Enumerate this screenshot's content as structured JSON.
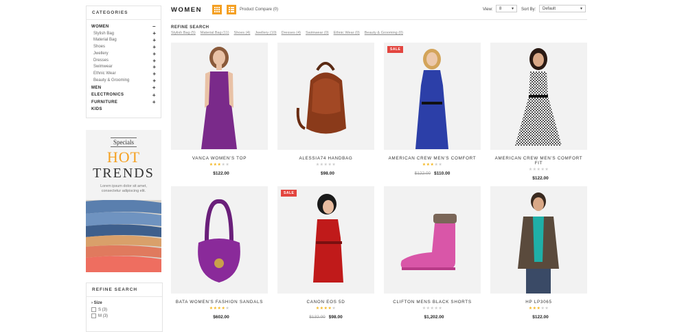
{
  "sidebar": {
    "categories_title": "CATEGORIES",
    "women": "WOMEN",
    "sub": [
      "Stylish Bag",
      "Material Bag",
      "Shoes",
      "Jwellery",
      "Dresses",
      "Swimwear",
      "Ethnic Wear",
      "Beauty & Grooming"
    ],
    "men": "MEN",
    "electronics": "ELECTRONICS",
    "furniture": "FURNITURE",
    "kids": "KIDS",
    "minus": "−",
    "plus": "+"
  },
  "promo": {
    "specials": "Specials",
    "hot": "HOT",
    "trends": "TRENDS",
    "lorem": "Lorem ipsum dolor sit amet, consectetur adipiscing elit."
  },
  "refine_box": {
    "title": "REFINE SEARCH",
    "size_label": "Size",
    "opt1": "S (3)",
    "opt2": "M (3)"
  },
  "toolbar": {
    "title": "WOMEN",
    "compare": "Product Compare (0)",
    "view_label": "View:",
    "view_value": "8",
    "sort_label": "Sort By:",
    "sort_value": "Default"
  },
  "refine_strip": {
    "label": "REFINE SEARCH",
    "links": [
      "Stylish Bag (5)",
      "Material Bag (11)",
      "Shoes (4)",
      "Jwellery (10)",
      "Dresses (4)",
      "Swimwear (0)",
      "Ethnic Wear (0)",
      "Beauty & Grooming (0)"
    ]
  },
  "products": [
    {
      "name": "VANCA WOMEN'S TOP",
      "price": "$122.00",
      "old": "",
      "sale": "",
      "rating": 3
    },
    {
      "name": "ALESSIA74 HANDBAG",
      "price": "$98.00",
      "old": "",
      "sale": "",
      "rating": 0
    },
    {
      "name": "AMERICAN CREW MEN'S COMFORT",
      "price": "$110.00",
      "old": "$122.00",
      "sale": "SALE",
      "rating": 3
    },
    {
      "name": "AMERICAN CREW MEN'S COMFORT FIT",
      "price": "$122.00",
      "old": "",
      "sale": "",
      "rating": 0
    },
    {
      "name": "BATA WOMEN'S FASHION SANDALS",
      "price": "$602.00",
      "old": "",
      "sale": "",
      "rating": 4
    },
    {
      "name": "CANON EOS 5D",
      "price": "$98.00",
      "old": "$132.00",
      "sale": "SALE",
      "rating": 4
    },
    {
      "name": "CLIFTON MENS BLACK SHORTS",
      "price": "$1,202.00",
      "old": "",
      "sale": "",
      "rating": 0
    },
    {
      "name": "HP LP3065",
      "price": "$122.00",
      "old": "",
      "sale": "",
      "rating": 3
    }
  ],
  "colors": {
    "accent": "#f4a023",
    "sale": "#e3453f",
    "star": "#f3b61f"
  }
}
